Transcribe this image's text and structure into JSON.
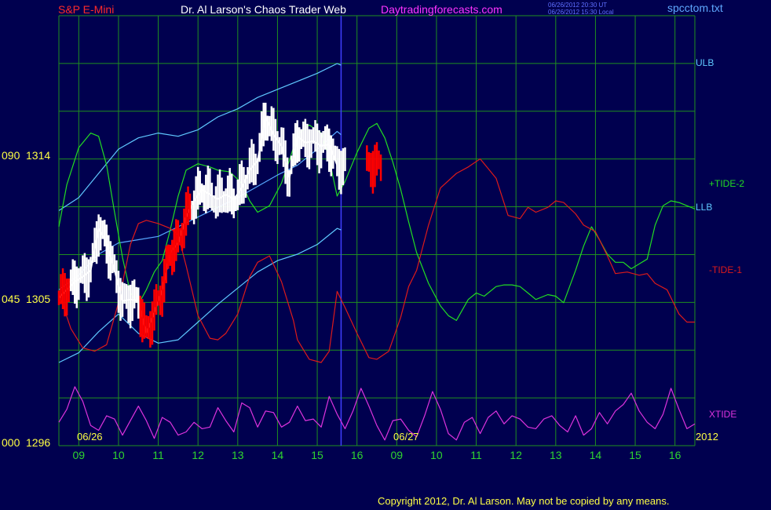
{
  "header": {
    "symbol": "S&P E-Mini",
    "title": "Dr. Al Larson's Chaos Trader Web",
    "site": "Daytradingforecasts.com",
    "time_utc": "06/26/2012 20:30 UT",
    "time_local": "06/26/2012 15:30 Local",
    "file": "spcctom.txt"
  },
  "footer": {
    "copyright": "Copyright 2012, Dr. Al Larson. May not be copied by any means."
  },
  "colors": {
    "background": "#00004f",
    "grid": "#1f8f1f",
    "price_up": "#ffffff",
    "price_down": "#ff0000",
    "ulb_llb": "#5fc8ff",
    "inner_band": "#57a8ff",
    "tide2": "#22dd22",
    "tide1": "#dd1a1a",
    "xtide": "#dd33dd",
    "symbol": "#ff2a2a",
    "site": "#ff33ff",
    "axis_text": "#ffff44",
    "hour_text": "#2fd52f",
    "divider": "#4040ff"
  },
  "chart_data": {
    "type": "line",
    "title": "S&P E-Mini",
    "y_axis_labels": [
      {
        "counter": "090",
        "price": "1314",
        "value": 1314
      },
      {
        "counter": "045",
        "price": "1305",
        "value": 1305
      },
      {
        "counter": "000",
        "price": "1296",
        "value": 1296
      }
    ],
    "ylim": [
      1296,
      1314
    ],
    "x_hours": [
      "09",
      "10",
      "11",
      "12",
      "13",
      "14",
      "15",
      "16",
      "09",
      "10",
      "11",
      "12",
      "13",
      "14",
      "15",
      "16"
    ],
    "x_dates": [
      "06/26",
      "06/27"
    ],
    "year": "2012",
    "right_labels": [
      "ULB",
      "+TIDE-2",
      "LLB",
      "-TIDE-1",
      "XTIDE"
    ],
    "series": [
      {
        "name": "ULB",
        "color": "#5fc8ff",
        "x": [
          0.0,
          0.5,
          1.0,
          1.5,
          2.0,
          2.5,
          3.0,
          3.5,
          4.0,
          4.5,
          5.0,
          5.5,
          6.0,
          6.5,
          7.0,
          7.1
        ],
        "y": [
          1311.1,
          1311.9,
          1313.4,
          1314.9,
          1315.6,
          1315.9,
          1315.7,
          1316.1,
          1316.9,
          1317.4,
          1318.1,
          1318.6,
          1319.1,
          1319.6,
          1320.2,
          1320.1
        ]
      },
      {
        "name": "Middle Band",
        "color": "#57a8ff",
        "x": [
          0.0,
          0.5,
          1.0,
          1.5,
          2.0,
          2.5,
          3.0,
          3.5,
          4.0,
          4.5,
          5.0,
          5.5,
          6.0,
          6.5,
          7.0,
          7.1
        ],
        "y": [
          1306.2,
          1307.1,
          1308.4,
          1309.1,
          1309.3,
          1309.5,
          1310.1,
          1310.7,
          1311.3,
          1311.9,
          1312.6,
          1313.3,
          1313.9,
          1314.9,
          1316.0,
          1315.8
        ]
      },
      {
        "name": "LLB",
        "color": "#5fc8ff",
        "x": [
          0.0,
          0.5,
          1.0,
          1.5,
          2.0,
          2.5,
          3.0,
          3.5,
          4.0,
          4.5,
          5.0,
          5.5,
          6.0,
          6.5,
          7.0,
          7.1
        ],
        "y": [
          1301.7,
          1302.3,
          1303.6,
          1304.7,
          1303.5,
          1302.9,
          1303.1,
          1304.2,
          1305.3,
          1306.3,
          1307.3,
          1308.0,
          1308.4,
          1309.0,
          1310.0,
          1309.9
        ]
      },
      {
        "name": "+TIDE-2",
        "color": "#22dd22",
        "x": [
          0.0,
          0.2,
          0.5,
          0.8,
          1.0,
          1.2,
          1.4,
          1.6,
          1.8,
          2.0,
          2.2,
          2.4,
          2.6,
          2.8,
          3.0,
          3.2,
          3.5,
          3.8,
          4.0,
          4.3,
          4.6,
          4.8,
          5.0,
          5.3,
          5.6,
          5.8,
          6.0,
          6.3,
          6.6,
          6.8,
          7.0,
          7.2,
          7.5,
          7.8,
          8.0,
          8.2,
          8.4,
          8.6,
          8.8,
          9.0,
          9.3,
          9.6,
          9.8,
          10.0,
          10.3,
          10.5,
          10.7,
          11.0,
          11.2,
          11.4,
          11.6,
          11.8,
          12.0,
          12.3,
          12.5,
          12.7,
          13.0,
          13.2,
          13.4,
          13.6,
          13.8,
          14.0,
          14.2,
          14.4,
          14.6,
          14.8,
          15.0,
          15.2,
          15.4,
          15.6,
          15.8,
          16.0
        ],
        "y": [
          1310.1,
          1312.7,
          1315.0,
          1315.9,
          1315.7,
          1313.9,
          1311.0,
          1308.2,
          1306.0,
          1305.3,
          1306.2,
          1307.3,
          1308.0,
          1309.9,
          1312.0,
          1313.6,
          1314.0,
          1313.8,
          1313.6,
          1313.5,
          1312.8,
          1311.7,
          1311.0,
          1311.4,
          1312.8,
          1314.2,
          1315.8,
          1316.4,
          1315.9,
          1314.3,
          1312.0,
          1312.9,
          1314.7,
          1316.2,
          1316.5,
          1315.6,
          1314.1,
          1312.4,
          1310.4,
          1308.5,
          1306.6,
          1305.2,
          1304.6,
          1304.3,
          1305.6,
          1306.0,
          1305.8,
          1306.4,
          1306.5,
          1306.5,
          1306.4,
          1306.0,
          1305.6,
          1305.9,
          1305.8,
          1305.4,
          1307.4,
          1308.9,
          1310.1,
          1309.3,
          1308.4,
          1307.9,
          1307.9,
          1307.5,
          1307.8,
          1308.1,
          1310.2,
          1311.4,
          1311.7,
          1311.6,
          1311.4,
          1311.2
        ]
      },
      {
        "name": "-TIDE-1",
        "color": "#dd1a1a",
        "x": [
          0.0,
          0.3,
          0.6,
          0.9,
          1.2,
          1.5,
          1.8,
          2.0,
          2.2,
          2.5,
          2.8,
          3.0,
          3.2,
          3.5,
          3.8,
          4.0,
          4.2,
          4.5,
          4.8,
          5.0,
          5.3,
          5.6,
          5.9,
          6.0,
          6.3,
          6.6,
          6.8,
          7.0,
          7.2,
          7.5,
          7.8,
          8.0,
          8.3,
          8.6,
          8.8,
          9.0,
          9.3,
          9.6,
          10.0,
          10.3,
          10.6,
          10.8,
          11.0,
          11.3,
          11.6,
          11.8,
          12.0,
          12.3,
          12.5,
          12.7,
          13.0,
          13.2,
          13.5,
          13.8,
          14.0,
          14.3,
          14.6,
          14.8,
          15.0,
          15.3,
          15.6,
          15.8,
          16.0
        ],
        "y": [
          1306.0,
          1303.8,
          1302.6,
          1302.4,
          1302.8,
          1305.4,
          1309.0,
          1310.3,
          1310.5,
          1310.3,
          1310.0,
          1309.6,
          1307.7,
          1304.6,
          1303.2,
          1303.1,
          1303.5,
          1304.7,
          1307.0,
          1307.9,
          1308.3,
          1306.7,
          1304.3,
          1303.1,
          1301.9,
          1301.7,
          1302.4,
          1306.1,
          1305.1,
          1303.5,
          1302.0,
          1301.9,
          1302.4,
          1304.5,
          1306.4,
          1307.4,
          1310.2,
          1312.5,
          1313.4,
          1313.8,
          1314.3,
          1313.7,
          1313.1,
          1310.8,
          1310.6,
          1311.3,
          1311.0,
          1311.3,
          1311.7,
          1311.6,
          1310.9,
          1310.2,
          1309.8,
          1308.3,
          1307.2,
          1307.3,
          1307.1,
          1307.2,
          1306.6,
          1306.2,
          1304.7,
          1304.2,
          1304.2
        ]
      },
      {
        "name": "XTIDE",
        "color": "#dd33dd",
        "x": [
          0.0,
          0.2,
          0.4,
          0.6,
          0.8,
          1.0,
          1.2,
          1.4,
          1.6,
          1.8,
          2.0,
          2.2,
          2.4,
          2.6,
          2.8,
          3.0,
          3.2,
          3.4,
          3.6,
          3.8,
          4.0,
          4.2,
          4.4,
          4.6,
          4.8,
          5.0,
          5.2,
          5.4,
          5.6,
          5.8,
          6.0,
          6.2,
          6.4,
          6.6,
          6.8,
          7.0,
          7.2,
          7.4,
          7.6,
          7.8,
          8.0,
          8.2,
          8.4,
          8.6,
          8.8,
          9.0,
          9.2,
          9.4,
          9.6,
          9.8,
          10.0,
          10.2,
          10.4,
          10.6,
          10.8,
          11.0,
          11.2,
          11.4,
          11.6,
          11.8,
          12.0,
          12.2,
          12.4,
          12.6,
          12.8,
          13.0,
          13.2,
          13.4,
          13.6,
          13.8,
          14.0,
          14.2,
          14.4,
          14.6,
          14.8,
          15.0,
          15.2,
          15.4,
          15.6,
          15.8,
          16.0
        ],
        "y": [
          1298.0,
          1298.8,
          1300.2,
          1299.3,
          1297.8,
          1297.5,
          1298.4,
          1298.2,
          1297.2,
          1298.1,
          1299.0,
          1298.1,
          1297.0,
          1298.3,
          1298.0,
          1297.2,
          1297.4,
          1298.0,
          1297.6,
          1297.7,
          1298.9,
          1298.1,
          1297.4,
          1299.2,
          1298.9,
          1297.7,
          1298.7,
          1298.6,
          1297.7,
          1298.0,
          1299.0,
          1298.1,
          1298.2,
          1297.7,
          1299.6,
          1298.5,
          1297.6,
          1298.7,
          1300.1,
          1299.0,
          1297.8,
          1296.9,
          1298.1,
          1298.2,
          1297.5,
          1297.1,
          1298.4,
          1299.9,
          1298.8,
          1297.3,
          1296.9,
          1298.0,
          1298.3,
          1297.3,
          1298.3,
          1298.7,
          1297.9,
          1298.4,
          1298.2,
          1297.7,
          1297.6,
          1298.2,
          1298.4,
          1297.8,
          1297.4,
          1298.4,
          1297.2,
          1297.6,
          1298.6,
          1297.9,
          1298.7,
          1299.1,
          1299.8,
          1298.7,
          1298.0,
          1297.6,
          1298.5,
          1300.1,
          1298.8,
          1297.6,
          1297.9
        ]
      },
      {
        "name": "Price",
        "color": "#ffffff",
        "x": [
          0.0,
          0.2,
          0.4,
          0.6,
          0.8,
          1.0,
          1.2,
          1.4,
          1.6,
          1.8,
          2.0,
          2.2,
          2.4,
          2.6,
          2.8,
          3.0,
          3.2,
          3.4,
          3.6,
          3.8,
          4.0,
          4.2,
          4.4,
          4.6,
          4.8,
          5.0,
          5.2,
          5.4,
          5.6,
          5.8,
          6.0,
          6.2,
          6.4,
          6.6,
          6.8,
          7.0
        ],
        "y": [
          1305.7,
          1306.2,
          1306.7,
          1307.0,
          1307.4,
          1310.0,
          1309.1,
          1307.4,
          1305.5,
          1305.6,
          1305.5,
          1303.5,
          1304.8,
          1306.2,
          1308.5,
          1309.1,
          1310.7,
          1311.7,
          1312.4,
          1312.1,
          1311.8,
          1312.1,
          1311.8,
          1312.5,
          1313.6,
          1314.2,
          1316.9,
          1315.8,
          1315.1,
          1313.1,
          1315.7,
          1315.3,
          1315.4,
          1315.1,
          1315.2,
          1313.9
        ]
      }
    ]
  }
}
